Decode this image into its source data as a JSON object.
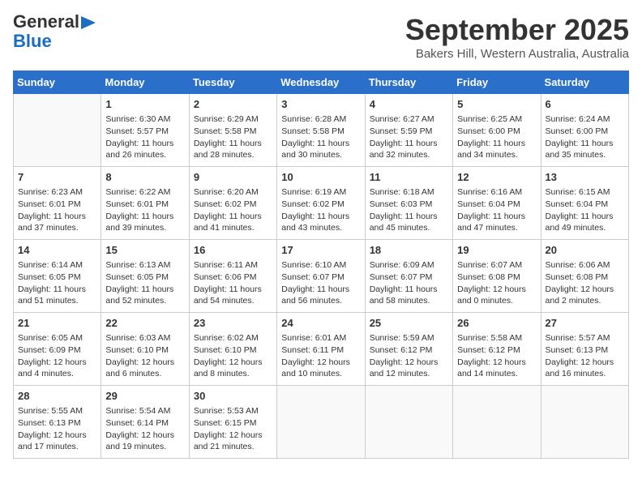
{
  "logo": {
    "top": "General",
    "arrow_color": "#1a6dc0",
    "bottom": "Blue"
  },
  "title": "September 2025",
  "subtitle": "Bakers Hill, Western Australia, Australia",
  "weekdays": [
    "Sunday",
    "Monday",
    "Tuesday",
    "Wednesday",
    "Thursday",
    "Friday",
    "Saturday"
  ],
  "weeks": [
    [
      {
        "day": "",
        "content": ""
      },
      {
        "day": "1",
        "content": "Sunrise: 6:30 AM\nSunset: 5:57 PM\nDaylight: 11 hours\nand 26 minutes."
      },
      {
        "day": "2",
        "content": "Sunrise: 6:29 AM\nSunset: 5:58 PM\nDaylight: 11 hours\nand 28 minutes."
      },
      {
        "day": "3",
        "content": "Sunrise: 6:28 AM\nSunset: 5:58 PM\nDaylight: 11 hours\nand 30 minutes."
      },
      {
        "day": "4",
        "content": "Sunrise: 6:27 AM\nSunset: 5:59 PM\nDaylight: 11 hours\nand 32 minutes."
      },
      {
        "day": "5",
        "content": "Sunrise: 6:25 AM\nSunset: 6:00 PM\nDaylight: 11 hours\nand 34 minutes."
      },
      {
        "day": "6",
        "content": "Sunrise: 6:24 AM\nSunset: 6:00 PM\nDaylight: 11 hours\nand 35 minutes."
      }
    ],
    [
      {
        "day": "7",
        "content": "Sunrise: 6:23 AM\nSunset: 6:01 PM\nDaylight: 11 hours\nand 37 minutes."
      },
      {
        "day": "8",
        "content": "Sunrise: 6:22 AM\nSunset: 6:01 PM\nDaylight: 11 hours\nand 39 minutes."
      },
      {
        "day": "9",
        "content": "Sunrise: 6:20 AM\nSunset: 6:02 PM\nDaylight: 11 hours\nand 41 minutes."
      },
      {
        "day": "10",
        "content": "Sunrise: 6:19 AM\nSunset: 6:02 PM\nDaylight: 11 hours\nand 43 minutes."
      },
      {
        "day": "11",
        "content": "Sunrise: 6:18 AM\nSunset: 6:03 PM\nDaylight: 11 hours\nand 45 minutes."
      },
      {
        "day": "12",
        "content": "Sunrise: 6:16 AM\nSunset: 6:04 PM\nDaylight: 11 hours\nand 47 minutes."
      },
      {
        "day": "13",
        "content": "Sunrise: 6:15 AM\nSunset: 6:04 PM\nDaylight: 11 hours\nand 49 minutes."
      }
    ],
    [
      {
        "day": "14",
        "content": "Sunrise: 6:14 AM\nSunset: 6:05 PM\nDaylight: 11 hours\nand 51 minutes."
      },
      {
        "day": "15",
        "content": "Sunrise: 6:13 AM\nSunset: 6:05 PM\nDaylight: 11 hours\nand 52 minutes."
      },
      {
        "day": "16",
        "content": "Sunrise: 6:11 AM\nSunset: 6:06 PM\nDaylight: 11 hours\nand 54 minutes."
      },
      {
        "day": "17",
        "content": "Sunrise: 6:10 AM\nSunset: 6:07 PM\nDaylight: 11 hours\nand 56 minutes."
      },
      {
        "day": "18",
        "content": "Sunrise: 6:09 AM\nSunset: 6:07 PM\nDaylight: 11 hours\nand 58 minutes."
      },
      {
        "day": "19",
        "content": "Sunrise: 6:07 AM\nSunset: 6:08 PM\nDaylight: 12 hours\nand 0 minutes."
      },
      {
        "day": "20",
        "content": "Sunrise: 6:06 AM\nSunset: 6:08 PM\nDaylight: 12 hours\nand 2 minutes."
      }
    ],
    [
      {
        "day": "21",
        "content": "Sunrise: 6:05 AM\nSunset: 6:09 PM\nDaylight: 12 hours\nand 4 minutes."
      },
      {
        "day": "22",
        "content": "Sunrise: 6:03 AM\nSunset: 6:10 PM\nDaylight: 12 hours\nand 6 minutes."
      },
      {
        "day": "23",
        "content": "Sunrise: 6:02 AM\nSunset: 6:10 PM\nDaylight: 12 hours\nand 8 minutes."
      },
      {
        "day": "24",
        "content": "Sunrise: 6:01 AM\nSunset: 6:11 PM\nDaylight: 12 hours\nand 10 minutes."
      },
      {
        "day": "25",
        "content": "Sunrise: 5:59 AM\nSunset: 6:12 PM\nDaylight: 12 hours\nand 12 minutes."
      },
      {
        "day": "26",
        "content": "Sunrise: 5:58 AM\nSunset: 6:12 PM\nDaylight: 12 hours\nand 14 minutes."
      },
      {
        "day": "27",
        "content": "Sunrise: 5:57 AM\nSunset: 6:13 PM\nDaylight: 12 hours\nand 16 minutes."
      }
    ],
    [
      {
        "day": "28",
        "content": "Sunrise: 5:55 AM\nSunset: 6:13 PM\nDaylight: 12 hours\nand 17 minutes."
      },
      {
        "day": "29",
        "content": "Sunrise: 5:54 AM\nSunset: 6:14 PM\nDaylight: 12 hours\nand 19 minutes."
      },
      {
        "day": "30",
        "content": "Sunrise: 5:53 AM\nSunset: 6:15 PM\nDaylight: 12 hours\nand 21 minutes."
      },
      {
        "day": "",
        "content": ""
      },
      {
        "day": "",
        "content": ""
      },
      {
        "day": "",
        "content": ""
      },
      {
        "day": "",
        "content": ""
      }
    ]
  ]
}
